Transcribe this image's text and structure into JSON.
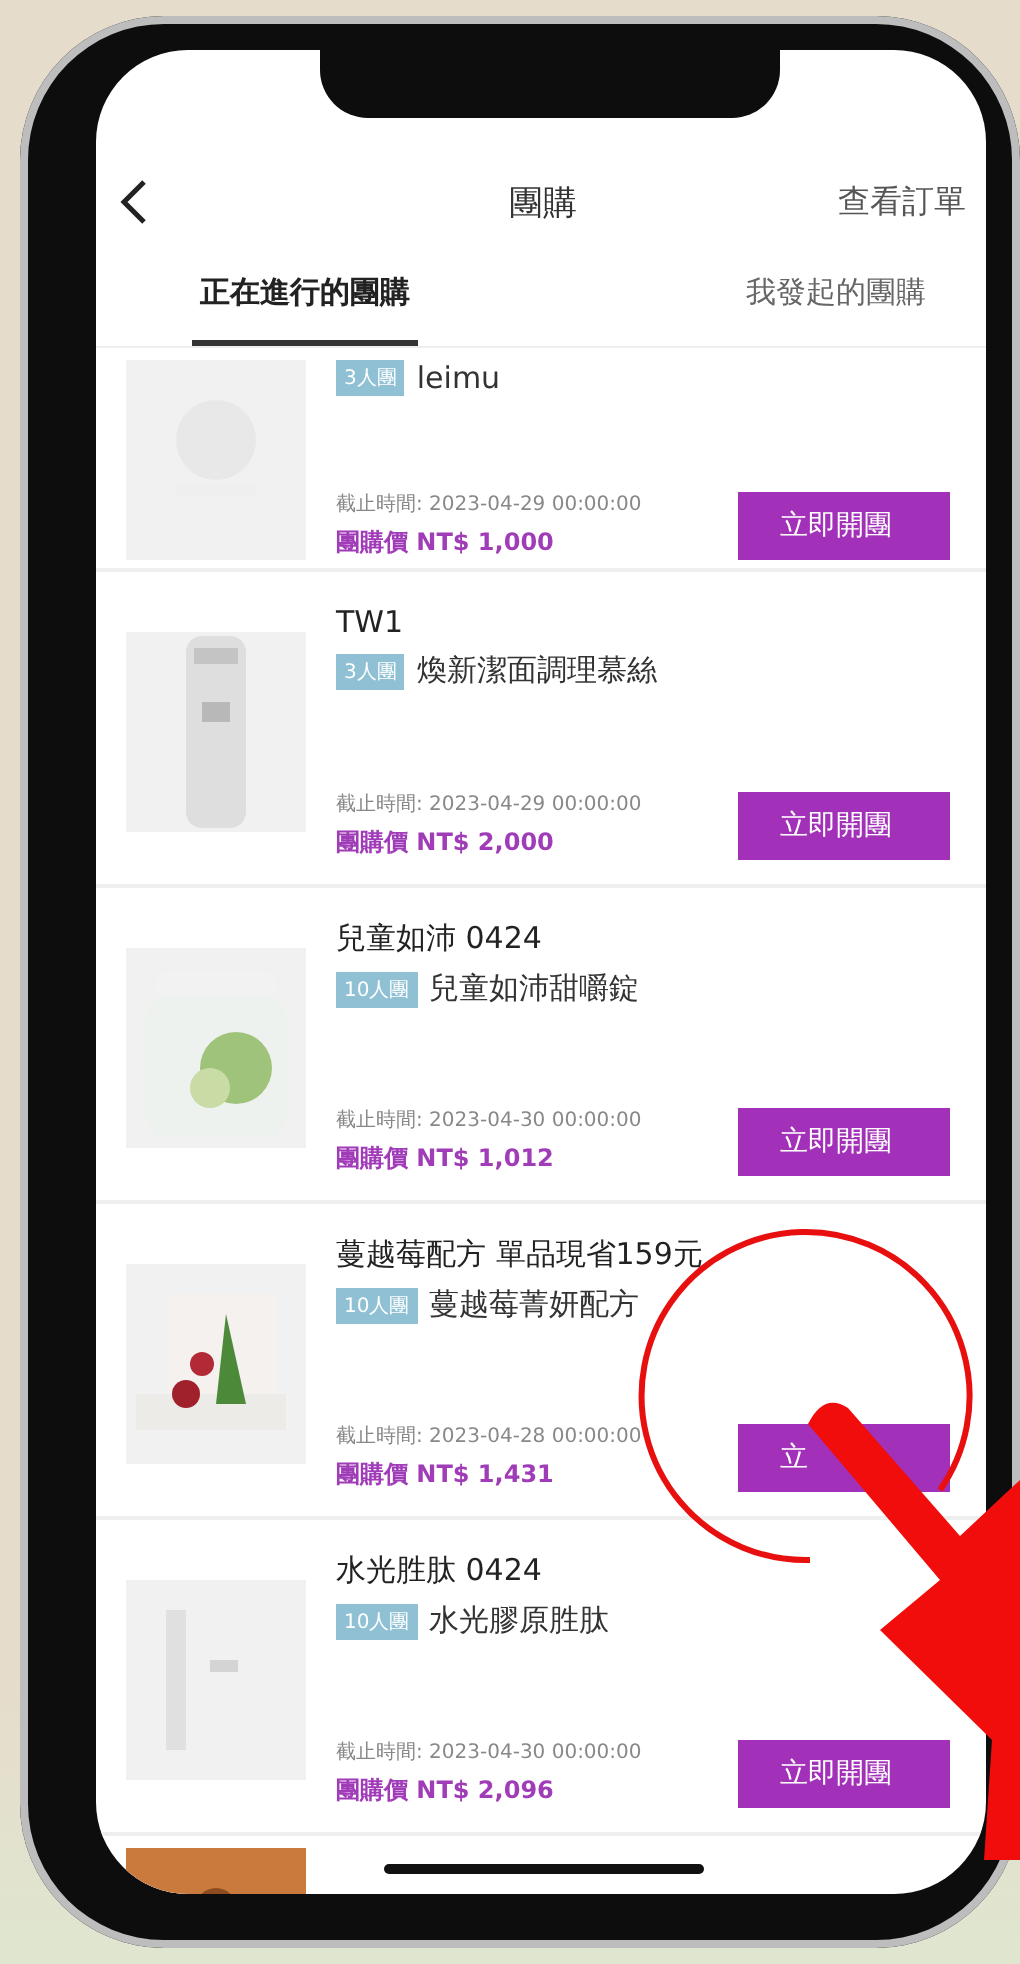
{
  "header": {
    "title": "團購",
    "action": "查看訂單"
  },
  "tabs": [
    {
      "label": "正在進行的團購",
      "selected": true
    },
    {
      "label": "我發起的團購",
      "selected": false
    }
  ],
  "items": [
    {
      "image": {
        "kind": "picture"
      },
      "badge": "3人團",
      "name": "leimu",
      "deadline": "截止時間: 2023-04-29 00:00:00",
      "price": "團購價 NT$ 1,000",
      "button": "立即開團"
    },
    {
      "image": {
        "kind": "picture"
      },
      "title": "TW1",
      "badge": "3人團",
      "name": "煥新潔面調理慕絲",
      "deadline": "截止時間: 2023-04-29 00:00:00",
      "price": "團購價 NT$ 2,000",
      "button": "立即開團"
    },
    {
      "image": {
        "kind": "picture"
      },
      "title": "兒童如沛 0424",
      "badge": "10人團",
      "name": "兒童如沛甜嚼錠",
      "deadline": "截止時間: 2023-04-30 00:00:00",
      "price": "團購價 NT$ 1,012",
      "button": "立即開團"
    },
    {
      "image": {
        "kind": "picture"
      },
      "title": "蔓越莓配方 單品現省159元",
      "badge": "10人團",
      "name": "蔓越莓菁妍配方",
      "deadline": "截止時間: 2023-04-28 00:00:00",
      "price": "團購價 NT$ 1,431",
      "button": "立"
    },
    {
      "image": {
        "kind": "picture"
      },
      "title": "水光胜肽 0424",
      "badge": "10人團",
      "name": "水光膠原胜肽",
      "deadline": "截止時間: 2023-04-30 00:00:00",
      "price": "團購價 NT$ 2,096",
      "button": "立即開團"
    },
    {
      "image": {
        "kind": "picture"
      }
    }
  ]
}
